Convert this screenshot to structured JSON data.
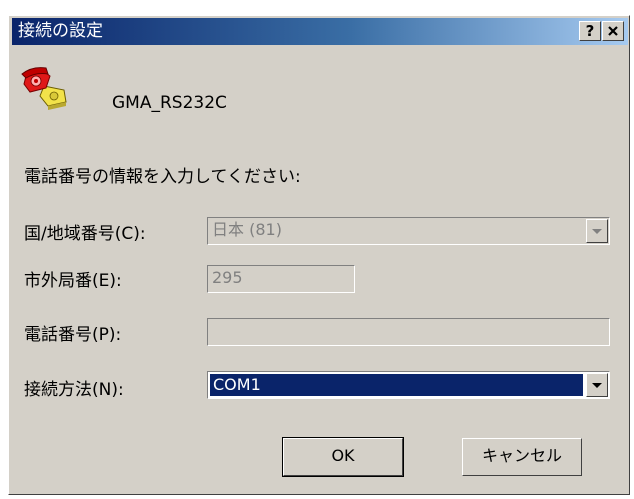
{
  "window": {
    "title": "接続の設定",
    "help_button": "?",
    "close_button": "✕"
  },
  "connection": {
    "name": "GMA_RS232C",
    "icon": "phone-connection-icon"
  },
  "prompt": "電話番号の情報を入力してください:",
  "fields": {
    "country": {
      "label": "国/地域番号(C):",
      "value": "日本 (81)"
    },
    "area_code": {
      "label": "市外局番(E):",
      "value": "295"
    },
    "phone": {
      "label": "電話番号(P):",
      "value": ""
    },
    "connect_using": {
      "label": "接続方法(N):",
      "value": "COM1"
    }
  },
  "buttons": {
    "ok": "OK",
    "cancel": "キャンセル"
  }
}
